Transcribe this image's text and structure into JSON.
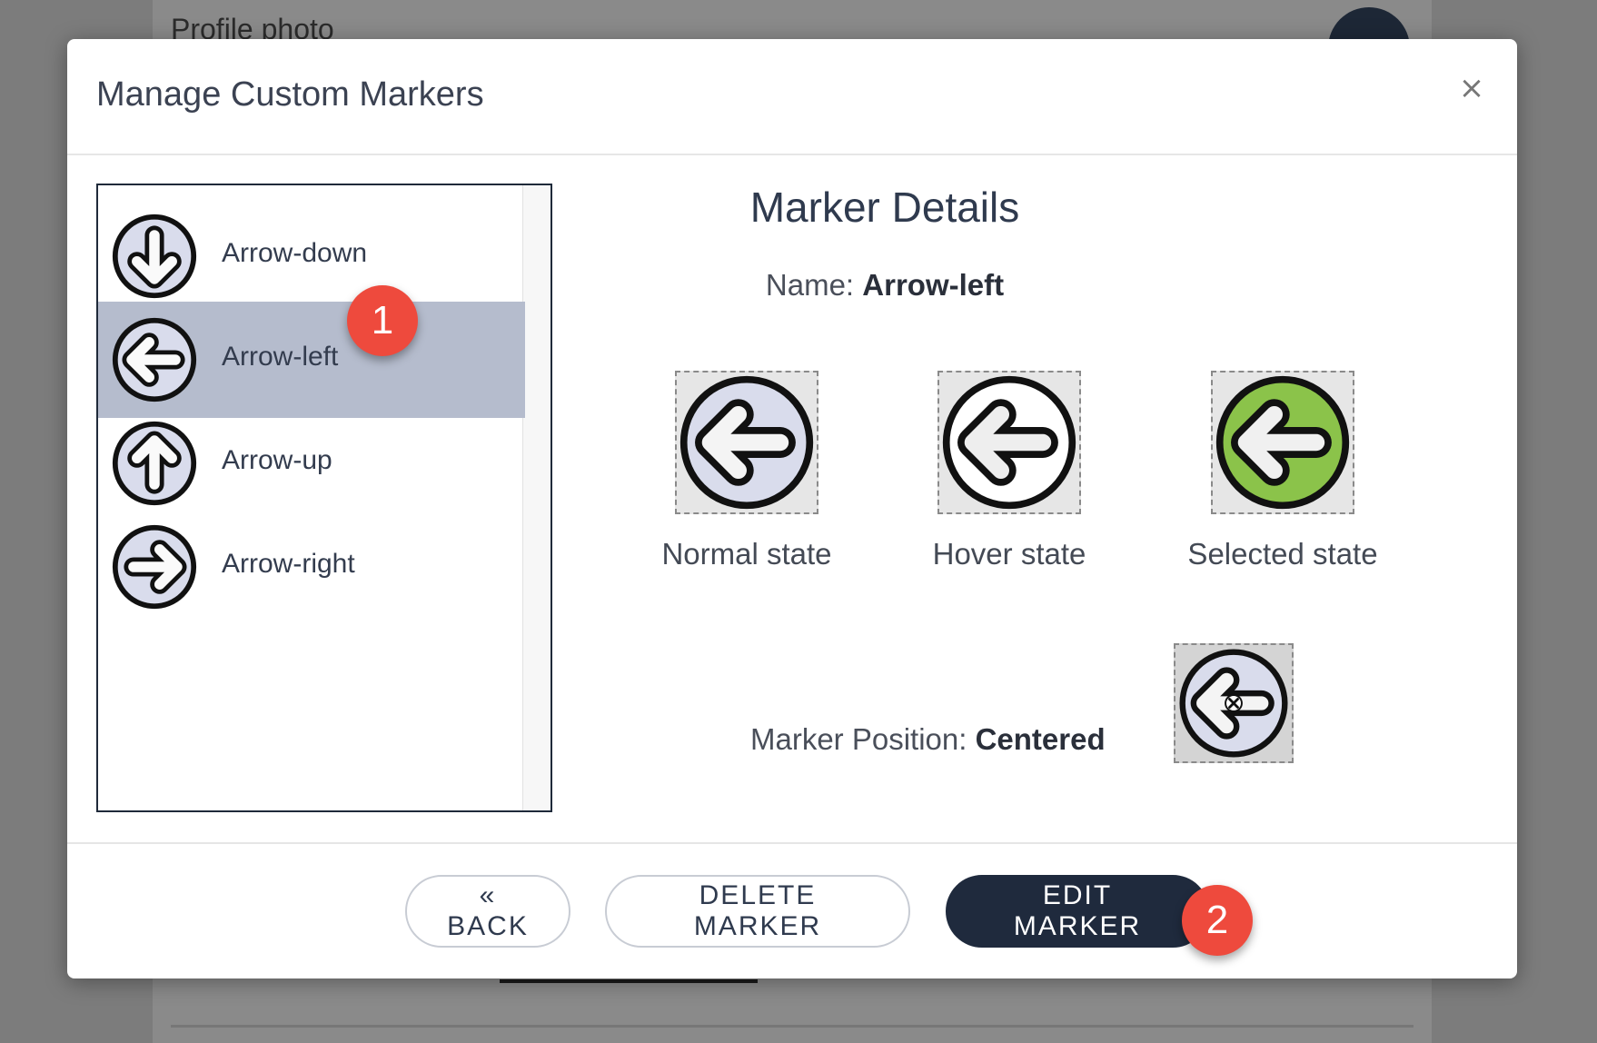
{
  "background": {
    "profile_label": "Profile photo"
  },
  "modal": {
    "title": "Manage Custom Markers",
    "close_glyph": "×",
    "close_icon": "close-icon"
  },
  "marker_list": {
    "items": [
      {
        "label": "Arrow-down",
        "icon": "arrow-down-icon",
        "selected": false
      },
      {
        "label": "Arrow-left",
        "icon": "arrow-left-icon",
        "selected": true
      },
      {
        "label": "Arrow-up",
        "icon": "arrow-up-icon",
        "selected": false
      },
      {
        "label": "Arrow-right",
        "icon": "arrow-right-icon",
        "selected": false
      }
    ]
  },
  "details": {
    "title": "Marker Details",
    "name_label": "Name:",
    "name_value": "Arrow-left",
    "states": [
      {
        "label": "Normal state",
        "fill": "#d9dcec"
      },
      {
        "label": "Hover state",
        "fill": "#ffffff"
      },
      {
        "label": "Selected state",
        "fill": "#8bc34a"
      }
    ],
    "position_label": "Marker Position:",
    "position_value": "Centered"
  },
  "footer": {
    "back_label": "« BACK",
    "delete_label": "DELETE MARKER",
    "edit_label": "EDIT MARKER"
  },
  "badges": {
    "step1": "1",
    "step2": "2"
  },
  "colors": {
    "selected_row": "#b5bccd",
    "primary_button": "#1f2a3d",
    "badge": "#ee4a3d",
    "selected_state_fill": "#8bc34a"
  }
}
